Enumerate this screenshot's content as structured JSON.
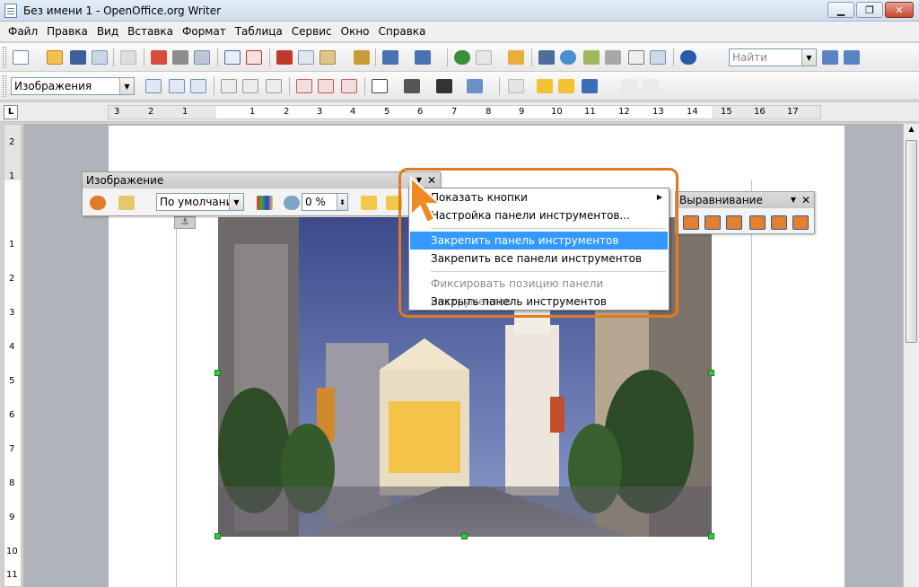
{
  "window": {
    "title": "Без имени 1 - OpenOffice.org Writer",
    "minimize": "▁",
    "restore": "❐",
    "close": "✕"
  },
  "menubar": {
    "items": [
      "Файл",
      "Правка",
      "Вид",
      "Вставка",
      "Формат",
      "Таблица",
      "Сервис",
      "Окно",
      "Справка"
    ]
  },
  "standard_toolbar": {
    "find_placeholder": "Найти"
  },
  "formatting_toolbar": {
    "style_value": "Изображения"
  },
  "rulers": {
    "corner": "L",
    "horizontal": [
      "3",
      "2",
      "1",
      "1",
      "2",
      "3",
      "4",
      "5",
      "6",
      "7",
      "8",
      "9",
      "10",
      "11",
      "12",
      "13",
      "14",
      "15",
      "16",
      "17"
    ],
    "vertical": [
      "2",
      "1",
      "1",
      "2",
      "3",
      "4",
      "5",
      "6",
      "7",
      "8",
      "9",
      "10",
      "11"
    ]
  },
  "image_toolbar": {
    "title": "Изображение",
    "filter_value": "По умолчани",
    "transparency_value": "0 %"
  },
  "align_toolbar": {
    "title": "Выравнивание"
  },
  "context_menu": {
    "show_buttons": "Показать кнопки",
    "customize": "Настройка панели инструментов...",
    "dock": "Закрепить панель инструментов",
    "dock_all": "Закрепить все панели инструментов",
    "lock_position": "Фиксировать позицию панели инструментов",
    "close": "Закрыть панель инструментов"
  },
  "colors": {
    "highlight": "#3399ff",
    "callout": "#e07a1f",
    "selection_handle": "#2ecc40"
  }
}
